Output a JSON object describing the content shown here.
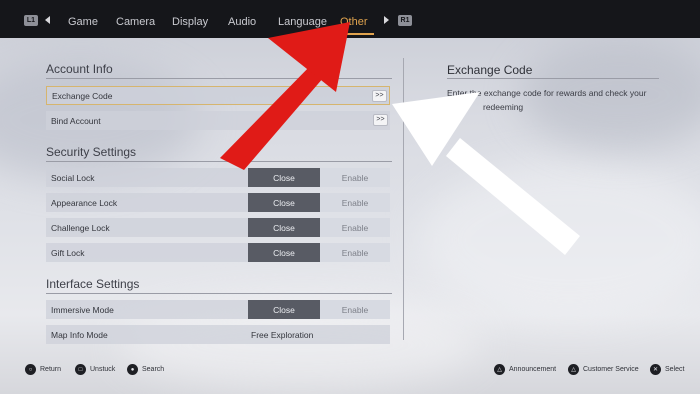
{
  "nav": {
    "left_shoulder": "L1",
    "right_shoulder": "R1",
    "tabs": [
      "Game",
      "Camera",
      "Display",
      "Audio",
      "Language",
      "Other"
    ],
    "active_tab": "Other"
  },
  "account_info": {
    "title": "Account Info",
    "rows": [
      {
        "label": "Exchange Code",
        "action": ">>"
      },
      {
        "label": "Bind Account",
        "action": ">>"
      }
    ]
  },
  "security_settings": {
    "title": "Security Settings",
    "rows": [
      {
        "label": "Social Lock",
        "close": "Close",
        "enable": "Enable"
      },
      {
        "label": "Appearance Lock",
        "close": "Close",
        "enable": "Enable"
      },
      {
        "label": "Challenge Lock",
        "close": "Close",
        "enable": "Enable"
      },
      {
        "label": "Gift Lock",
        "close": "Close",
        "enable": "Enable"
      }
    ]
  },
  "interface_settings": {
    "title": "Interface Settings",
    "rows": [
      {
        "label": "Immersive Mode",
        "close": "Close",
        "enable": "Enable"
      },
      {
        "label": "Map Info Mode",
        "value": "Free Exploration"
      }
    ]
  },
  "detail": {
    "title": "Exchange Code",
    "desc_line1": "Enter the exchange code for rewards and check your",
    "desc_line2": "redeeming"
  },
  "bottom_bar": {
    "return": "Return",
    "unstuck": "Unstuck",
    "search": "Search",
    "announcement": "Announcement",
    "customer_service": "Customer Service",
    "select": "Select"
  },
  "colors": {
    "accent": "#e0a34e",
    "toggle_active": "#585b64",
    "annotation_red": "#e01b17",
    "annotation_white": "#ffffff"
  }
}
